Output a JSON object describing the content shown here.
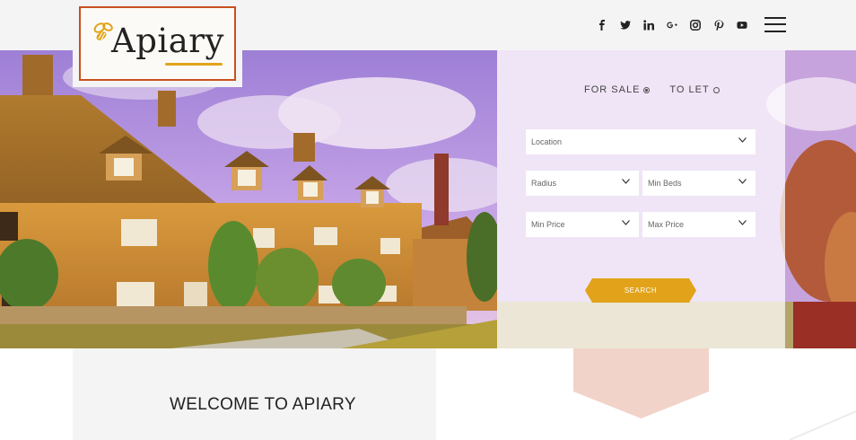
{
  "brand": {
    "name": "Apiary",
    "accent": "#e2a31a",
    "frame_color": "#c8501e"
  },
  "header": {
    "socials": [
      {
        "name": "facebook-icon",
        "glyph": "f"
      },
      {
        "name": "twitter-icon",
        "glyph": "t"
      },
      {
        "name": "linkedin-icon",
        "glyph": "in"
      },
      {
        "name": "google-plus-icon",
        "glyph": "g+"
      },
      {
        "name": "instagram-icon",
        "glyph": "ig"
      },
      {
        "name": "pinterest-icon",
        "glyph": "p"
      },
      {
        "name": "youtube-icon",
        "glyph": "yt"
      }
    ],
    "menu_icon": "hamburger-menu-icon"
  },
  "search": {
    "tabs": [
      {
        "label": "FOR SALE",
        "selected": true
      },
      {
        "label": "TO LET",
        "selected": false
      }
    ],
    "location_placeholder": "Location",
    "radius_placeholder": "Radius",
    "min_beds_placeholder": "Min Beds",
    "min_price_placeholder": "Min Price",
    "max_price_placeholder": "Max Price",
    "button_label": "SEARCH",
    "button_color": "#e2a31a"
  },
  "welcome": {
    "title": "WELCOME TO APIARY"
  },
  "colors": {
    "pink_accent": "#f2d3c9",
    "header_bg": "#f4f4f4"
  }
}
